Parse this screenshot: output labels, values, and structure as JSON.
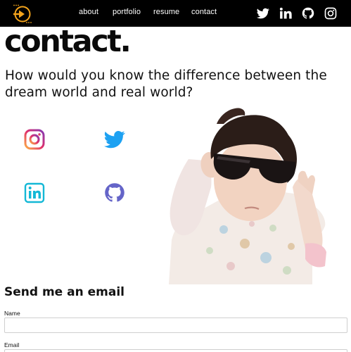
{
  "navbar": {
    "links": [
      {
        "label": "about"
      },
      {
        "label": "portfolio"
      },
      {
        "label": "resume"
      },
      {
        "label": "contact"
      }
    ],
    "social_icons": [
      "twitter-icon",
      "linkedin-icon",
      "github-icon",
      "instagram-icon"
    ]
  },
  "hero": {
    "title": "contact.",
    "tagline": "How would you know the difference between the dream world and real world?"
  },
  "social_grid": {
    "icons": [
      "instagram-icon",
      "twitter-icon",
      "linkedin-icon",
      "github-icon"
    ]
  },
  "email_form": {
    "heading": "Send me an email",
    "name_label": "Name",
    "name_value": "",
    "email_label": "Email",
    "email_value": ""
  },
  "colors": {
    "navbar_bg": "#000000",
    "logo_orange": "#f4a41c",
    "instagram_gradient": [
      "#fcaf45",
      "#e1306c",
      "#833ab4"
    ],
    "twitter_blue": "#1da1f2",
    "linkedin_cyan": "#14b8d6",
    "github_purple": "#6464c8"
  }
}
